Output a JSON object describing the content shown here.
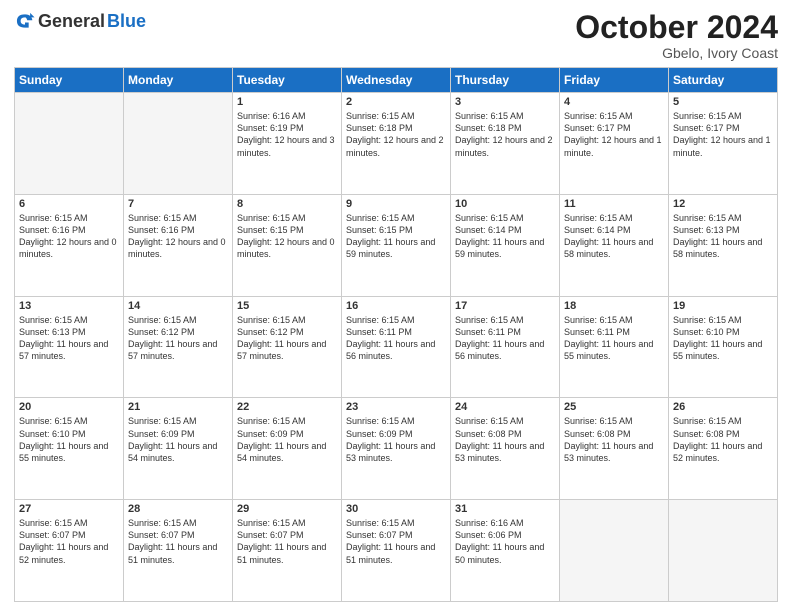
{
  "header": {
    "logo_general": "General",
    "logo_blue": "Blue",
    "month_title": "October 2024",
    "subtitle": "Gbelo, Ivory Coast"
  },
  "days_of_week": [
    "Sunday",
    "Monday",
    "Tuesday",
    "Wednesday",
    "Thursday",
    "Friday",
    "Saturday"
  ],
  "weeks": [
    [
      {
        "day": "",
        "detail": ""
      },
      {
        "day": "",
        "detail": ""
      },
      {
        "day": "1",
        "detail": "Sunrise: 6:16 AM\nSunset: 6:19 PM\nDaylight: 12 hours and 3 minutes."
      },
      {
        "day": "2",
        "detail": "Sunrise: 6:15 AM\nSunset: 6:18 PM\nDaylight: 12 hours and 2 minutes."
      },
      {
        "day": "3",
        "detail": "Sunrise: 6:15 AM\nSunset: 6:18 PM\nDaylight: 12 hours and 2 minutes."
      },
      {
        "day": "4",
        "detail": "Sunrise: 6:15 AM\nSunset: 6:17 PM\nDaylight: 12 hours and 1 minute."
      },
      {
        "day": "5",
        "detail": "Sunrise: 6:15 AM\nSunset: 6:17 PM\nDaylight: 12 hours and 1 minute."
      }
    ],
    [
      {
        "day": "6",
        "detail": "Sunrise: 6:15 AM\nSunset: 6:16 PM\nDaylight: 12 hours and 0 minutes."
      },
      {
        "day": "7",
        "detail": "Sunrise: 6:15 AM\nSunset: 6:16 PM\nDaylight: 12 hours and 0 minutes."
      },
      {
        "day": "8",
        "detail": "Sunrise: 6:15 AM\nSunset: 6:15 PM\nDaylight: 12 hours and 0 minutes."
      },
      {
        "day": "9",
        "detail": "Sunrise: 6:15 AM\nSunset: 6:15 PM\nDaylight: 11 hours and 59 minutes."
      },
      {
        "day": "10",
        "detail": "Sunrise: 6:15 AM\nSunset: 6:14 PM\nDaylight: 11 hours and 59 minutes."
      },
      {
        "day": "11",
        "detail": "Sunrise: 6:15 AM\nSunset: 6:14 PM\nDaylight: 11 hours and 58 minutes."
      },
      {
        "day": "12",
        "detail": "Sunrise: 6:15 AM\nSunset: 6:13 PM\nDaylight: 11 hours and 58 minutes."
      }
    ],
    [
      {
        "day": "13",
        "detail": "Sunrise: 6:15 AM\nSunset: 6:13 PM\nDaylight: 11 hours and 57 minutes."
      },
      {
        "day": "14",
        "detail": "Sunrise: 6:15 AM\nSunset: 6:12 PM\nDaylight: 11 hours and 57 minutes."
      },
      {
        "day": "15",
        "detail": "Sunrise: 6:15 AM\nSunset: 6:12 PM\nDaylight: 11 hours and 57 minutes."
      },
      {
        "day": "16",
        "detail": "Sunrise: 6:15 AM\nSunset: 6:11 PM\nDaylight: 11 hours and 56 minutes."
      },
      {
        "day": "17",
        "detail": "Sunrise: 6:15 AM\nSunset: 6:11 PM\nDaylight: 11 hours and 56 minutes."
      },
      {
        "day": "18",
        "detail": "Sunrise: 6:15 AM\nSunset: 6:11 PM\nDaylight: 11 hours and 55 minutes."
      },
      {
        "day": "19",
        "detail": "Sunrise: 6:15 AM\nSunset: 6:10 PM\nDaylight: 11 hours and 55 minutes."
      }
    ],
    [
      {
        "day": "20",
        "detail": "Sunrise: 6:15 AM\nSunset: 6:10 PM\nDaylight: 11 hours and 55 minutes."
      },
      {
        "day": "21",
        "detail": "Sunrise: 6:15 AM\nSunset: 6:09 PM\nDaylight: 11 hours and 54 minutes."
      },
      {
        "day": "22",
        "detail": "Sunrise: 6:15 AM\nSunset: 6:09 PM\nDaylight: 11 hours and 54 minutes."
      },
      {
        "day": "23",
        "detail": "Sunrise: 6:15 AM\nSunset: 6:09 PM\nDaylight: 11 hours and 53 minutes."
      },
      {
        "day": "24",
        "detail": "Sunrise: 6:15 AM\nSunset: 6:08 PM\nDaylight: 11 hours and 53 minutes."
      },
      {
        "day": "25",
        "detail": "Sunrise: 6:15 AM\nSunset: 6:08 PM\nDaylight: 11 hours and 53 minutes."
      },
      {
        "day": "26",
        "detail": "Sunrise: 6:15 AM\nSunset: 6:08 PM\nDaylight: 11 hours and 52 minutes."
      }
    ],
    [
      {
        "day": "27",
        "detail": "Sunrise: 6:15 AM\nSunset: 6:07 PM\nDaylight: 11 hours and 52 minutes."
      },
      {
        "day": "28",
        "detail": "Sunrise: 6:15 AM\nSunset: 6:07 PM\nDaylight: 11 hours and 51 minutes."
      },
      {
        "day": "29",
        "detail": "Sunrise: 6:15 AM\nSunset: 6:07 PM\nDaylight: 11 hours and 51 minutes."
      },
      {
        "day": "30",
        "detail": "Sunrise: 6:15 AM\nSunset: 6:07 PM\nDaylight: 11 hours and 51 minutes."
      },
      {
        "day": "31",
        "detail": "Sunrise: 6:16 AM\nSunset: 6:06 PM\nDaylight: 11 hours and 50 minutes."
      },
      {
        "day": "",
        "detail": ""
      },
      {
        "day": "",
        "detail": ""
      }
    ]
  ]
}
